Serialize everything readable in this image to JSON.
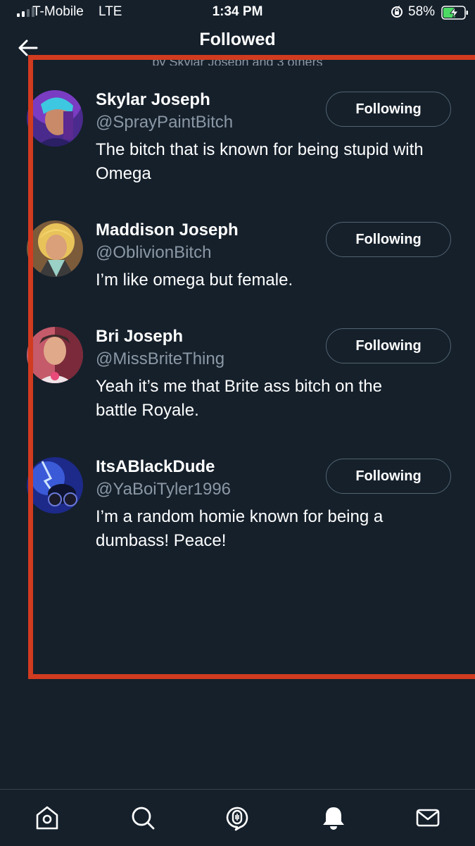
{
  "status_bar": {
    "carrier": "T-Mobile",
    "network": "LTE",
    "time": "1:34 PM",
    "battery": "58%",
    "battery_level": 0.58
  },
  "header": {
    "title": "Followed",
    "subtitle": "by Skylar Joseph and 3 others"
  },
  "users": [
    {
      "name": "Skylar Joseph",
      "handle": "@SprayPaintBitch",
      "bio": "The bitch that is known for being stupid with Omega",
      "button": "Following"
    },
    {
      "name": "Maddison Joseph",
      "handle": "@OblivionBitch",
      "bio": "I’m like omega but female.",
      "button": "Following"
    },
    {
      "name": "Bri Joseph",
      "handle": "@MissBriteThing",
      "bio": "Yeah it’s me that Brite ass bitch on the battle Royale.",
      "button": "Following"
    },
    {
      "name": "ItsABlackDude",
      "handle": "@YaBoiTyler1996",
      "bio": "I’m a random homie known for being a dumbass! Peace!",
      "button": "Following"
    }
  ],
  "tabs": [
    "home-icon",
    "search-icon",
    "spaces-icon",
    "notifications-icon",
    "messages-icon"
  ],
  "colors": {
    "background": "#15202b",
    "secondary_text": "#8b98a5",
    "button_border": "#536471",
    "annotation": "#d13b1f",
    "battery": "#4cd964"
  }
}
